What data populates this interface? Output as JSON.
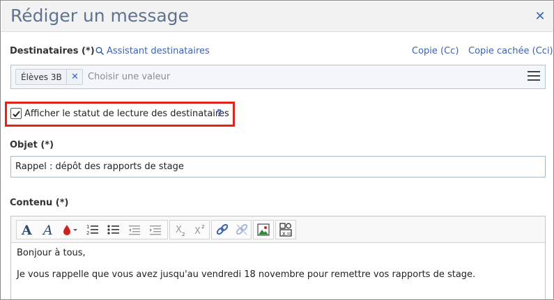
{
  "dialog": {
    "title": "Rédiger un message",
    "close_symbol": "✕"
  },
  "recipients": {
    "label": "Destinataires (*)",
    "assistant_link": "Assistant destinataires",
    "cc_link": "Copie (Cc)",
    "bcc_link": "Copie cachée (Cci)",
    "chips": [
      {
        "label": "Élèves 3B"
      }
    ],
    "placeholder": "Choisir une valeur"
  },
  "read_status": {
    "label": "Afficher le statut de lecture des destinataires",
    "checked": true,
    "help": "?"
  },
  "subject": {
    "label": "Objet (*)",
    "value": "Rappel : dépôt des rapports de stage"
  },
  "content": {
    "label": "Contenu (*)",
    "lines": [
      "Bonjour à tous,",
      "Je vous rappelle que vous avez jusqu'au vendredi 18 novembre pour remettre vos rapports de stage."
    ]
  },
  "toolbar": {
    "icons": [
      "font-size-icon",
      "font-italic-icon",
      "text-color-icon",
      "ordered-list-icon",
      "bullet-list-icon",
      "outdent-icon",
      "indent-icon",
      "subscript-icon",
      "superscript-icon",
      "link-icon",
      "unlink-icon",
      "image-icon",
      "formula-icon"
    ]
  },
  "colors": {
    "accent": "#3a62b3",
    "title": "#5d7390",
    "highlight": "#e2231a"
  }
}
